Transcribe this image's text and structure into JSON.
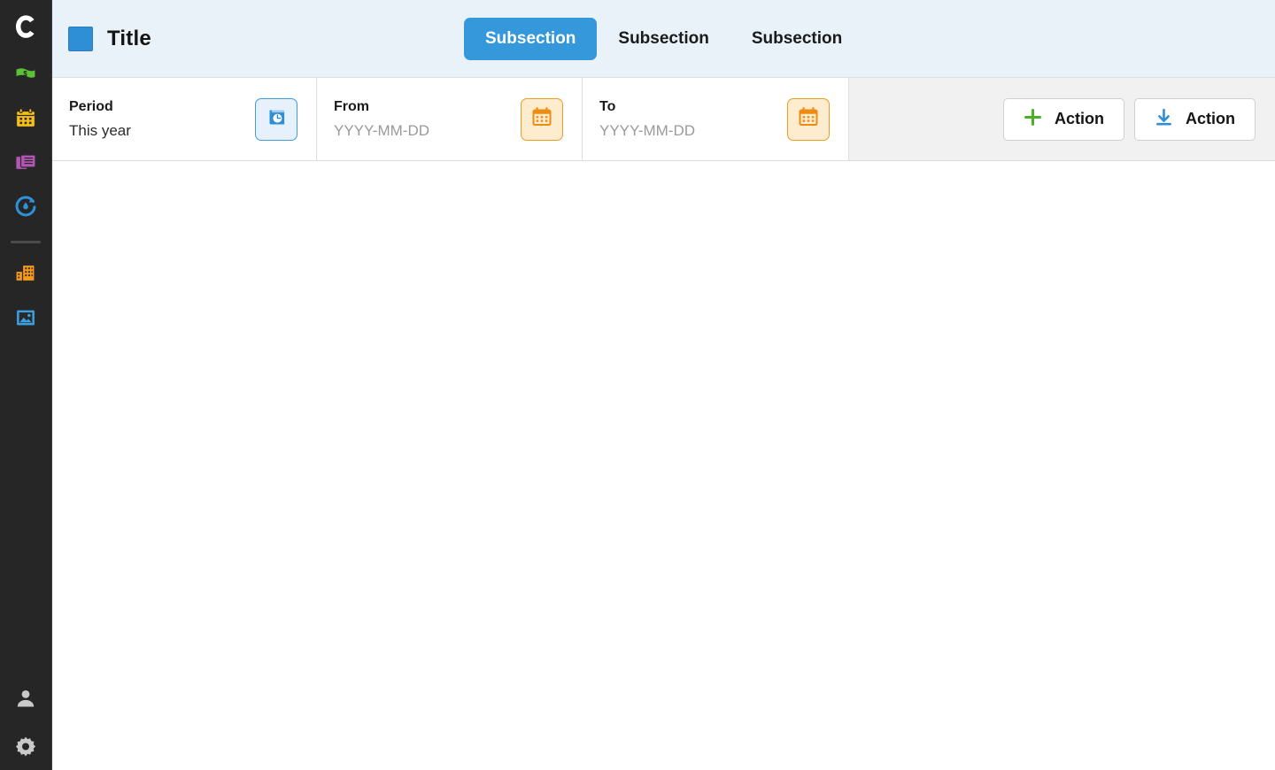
{
  "sidebar": {
    "logo": {
      "name": "app-logo-c",
      "letter": "C"
    },
    "items": [
      {
        "id": "money",
        "icon": "banknote-icon",
        "color": "#5bc236"
      },
      {
        "id": "calendar",
        "icon": "calendar-icon",
        "color": "#f5bf16"
      },
      {
        "id": "documents",
        "icon": "document-stack-icon",
        "color": "#b356b3"
      },
      {
        "id": "timer",
        "icon": "stopwatch-icon",
        "color": "#2e92d8"
      },
      {
        "id": "company",
        "icon": "building-icon",
        "color": "#f7981d"
      },
      {
        "id": "media",
        "icon": "image-icon",
        "color": "#3aa0e0"
      }
    ],
    "bottom_items": [
      {
        "id": "account",
        "icon": "user-icon",
        "color": "#c9c9c9"
      },
      {
        "id": "settings",
        "icon": "gear-icon",
        "color": "#c9c9c9"
      }
    ]
  },
  "header": {
    "title": "Title",
    "title_square_color": "#2e8ed6",
    "background_color": "#e9f2f9",
    "tabs": [
      {
        "label": "Subsection",
        "active": true
      },
      {
        "label": "Subsection",
        "active": false
      },
      {
        "label": "Subsection",
        "active": false
      }
    ],
    "active_tab_color": "#3498db"
  },
  "toolbar": {
    "period": {
      "label": "Period",
      "value": "This year",
      "icon": "period-book-clock-icon",
      "icon_color": "#2e8ed6"
    },
    "from": {
      "label": "From",
      "value": "",
      "placeholder": "YYYY-MM-DD",
      "icon": "calendar-icon",
      "icon_color": "#ef8b12"
    },
    "to": {
      "label": "To",
      "value": "",
      "placeholder": "YYYY-MM-DD",
      "icon": "calendar-icon",
      "icon_color": "#ef8b12"
    },
    "actions": [
      {
        "label": "Action",
        "icon": "plus-icon",
        "icon_color": "#4caf25"
      },
      {
        "label": "Action",
        "icon": "download-icon",
        "icon_color": "#2e8ed6"
      }
    ],
    "background_color": "#f1f1f1"
  },
  "content": {
    "empty": true
  }
}
